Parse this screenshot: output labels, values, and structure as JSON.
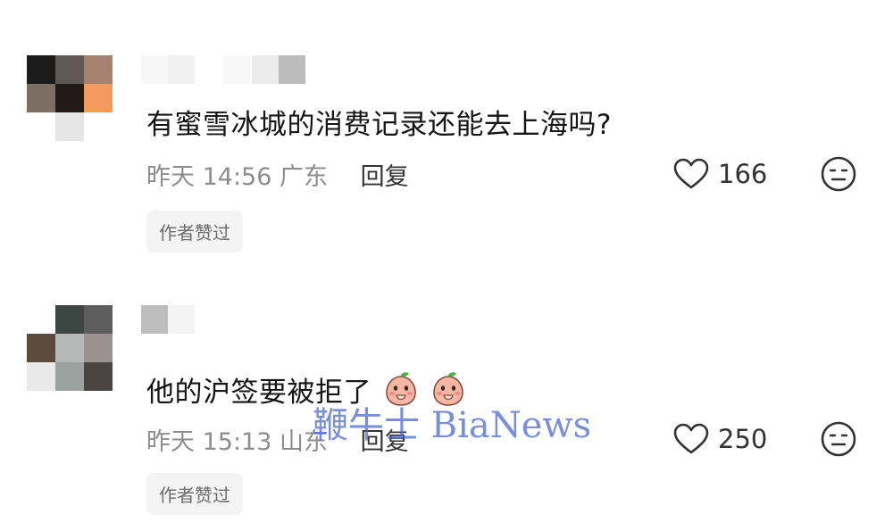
{
  "comments": [
    {
      "text": "有蜜雪冰城的消费记录还能去上海吗?",
      "time": "昨天 14:56",
      "location": "广东",
      "reply_label": "回复",
      "likes": "166",
      "badge": "作者赞过"
    },
    {
      "text": "他的沪签要被拒了",
      "time": "昨天 15:13",
      "location": "山东",
      "reply_label": "回复",
      "likes": "250",
      "badge": "作者赞过"
    }
  ],
  "watermark": "鞭牛士 BiaNews",
  "icons": {
    "like": "heart-outline-icon",
    "dislike": "meh-face-icon",
    "emoji": "peach-covering-mouth-emoji"
  },
  "colors": {
    "watermark": "#4664cd",
    "meta_text": "#8d8d8d",
    "badge_bg": "#f3f3f3"
  }
}
